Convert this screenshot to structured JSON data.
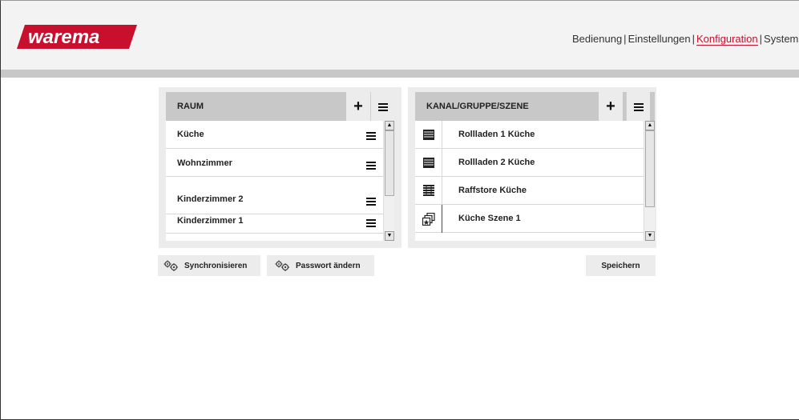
{
  "brand": {
    "logo_text": "warema",
    "color": "#c8102e"
  },
  "nav": {
    "items": [
      {
        "label": "Bedienung",
        "active": false
      },
      {
        "label": "Einstellungen",
        "active": false
      },
      {
        "label": "Konfiguration",
        "active": true
      },
      {
        "label": "System",
        "active": false
      }
    ],
    "separator": "|"
  },
  "room_panel": {
    "title": "RAUM",
    "add_icon": "plus-icon",
    "menu_icon": "menu-icon",
    "rooms": [
      {
        "label": "Küche",
        "icon": "menu-icon"
      },
      {
        "label": "Wohnzimmer",
        "icon": "menu-icon"
      },
      {
        "label": "Kinderzimmer 2",
        "icon": "menu-icon"
      },
      {
        "label": "Kinderzimmer 1",
        "icon": "menu-icon"
      }
    ]
  },
  "channel_panel": {
    "title": "KANAL/GRUPPE/SZENE",
    "add_icon": "plus-icon",
    "menu_icon": "menu-icon",
    "channels": [
      {
        "label": "Rollladen 1 Küche",
        "icon": "roller-shutter-icon"
      },
      {
        "label": "Rollladen 2 Küche",
        "icon": "roller-shutter-icon"
      },
      {
        "label": "Raffstore Küche",
        "icon": "venetian-blind-icon"
      },
      {
        "label": "Küche Szene 1",
        "icon": "scene-icon"
      }
    ]
  },
  "buttons": {
    "sync": "Synchronisieren",
    "password": "Passwort ändern",
    "save": "Speichern"
  }
}
